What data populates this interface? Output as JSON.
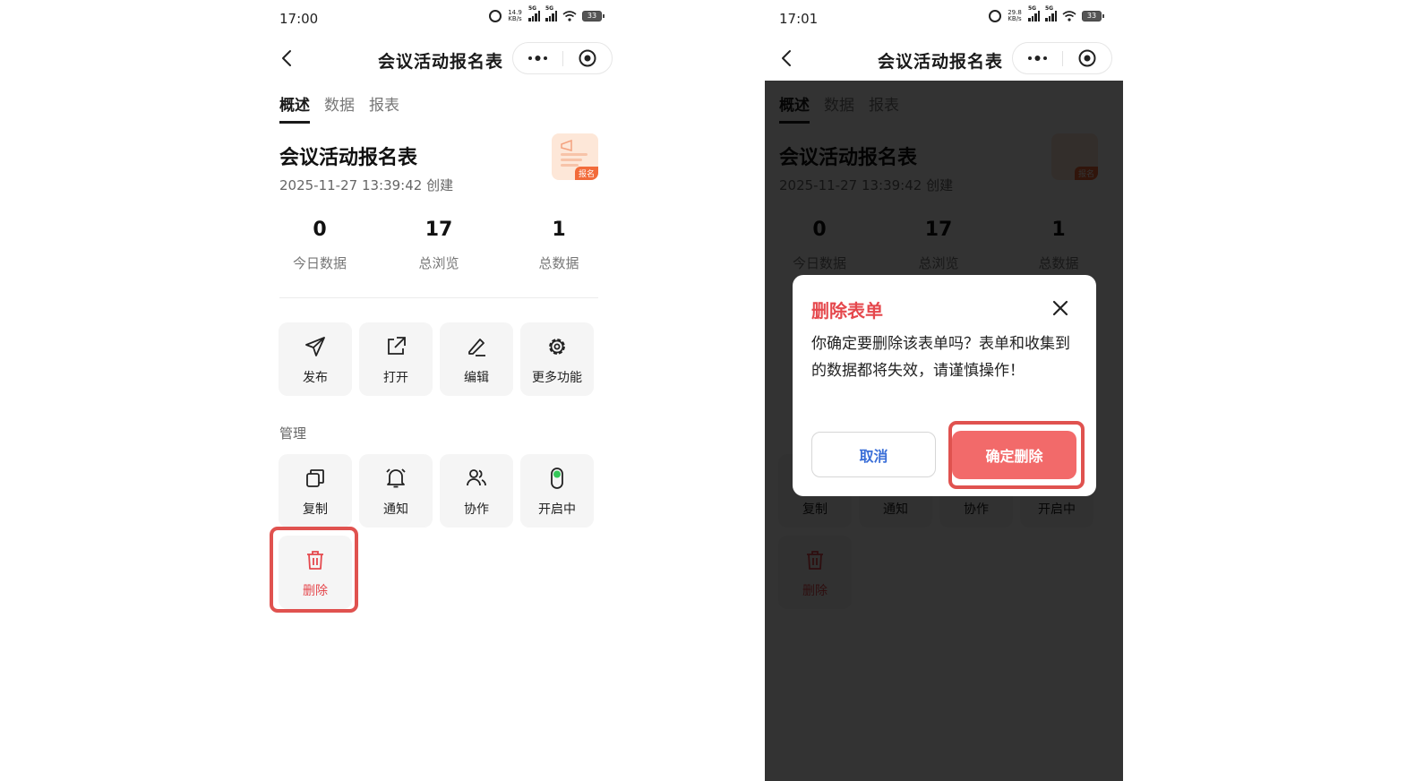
{
  "left_screen": {
    "status_time": "17:00",
    "status_speed": "14.9 KB/s",
    "network_label": "5G",
    "battery": "33",
    "nav_title": "会议活动报名表",
    "tabs": [
      {
        "label": "概述",
        "active": true
      },
      {
        "label": "数据",
        "active": false
      },
      {
        "label": "报表",
        "active": false
      }
    ],
    "form_title": "会议活动报名表",
    "form_created": "2025-11-27 13:39:42 创建",
    "thumb_tag": "报名",
    "stats": [
      {
        "value": "0",
        "label": "今日数据"
      },
      {
        "value": "17",
        "label": "总浏览"
      },
      {
        "value": "1",
        "label": "总数据"
      }
    ],
    "actions": [
      {
        "label": "发布",
        "icon": "send-icon"
      },
      {
        "label": "打开",
        "icon": "external-link-icon"
      },
      {
        "label": "编辑",
        "icon": "pencil-icon"
      },
      {
        "label": "更多功能",
        "icon": "gear-icon"
      }
    ],
    "manage_label": "管理",
    "manage": [
      {
        "label": "复制",
        "icon": "copy-icon"
      },
      {
        "label": "通知",
        "icon": "bell-icon"
      },
      {
        "label": "协作",
        "icon": "users-icon"
      },
      {
        "label": "开启中",
        "icon": "toggle-icon"
      }
    ],
    "delete_label": "删除"
  },
  "right_screen": {
    "status_time": "17:01",
    "status_speed": "29.8 KB/s",
    "dialog": {
      "title": "删除表单",
      "message": "你确定要删除该表单吗？表单和收集到的数据都将失效，请谨慎操作！",
      "cancel_label": "取消",
      "confirm_label": "确定删除"
    }
  },
  "colors": {
    "danger": "#e5484d",
    "confirm_button": "#f26a6a",
    "highlight": "#e0524f",
    "cancel_text": "#3b6fd8",
    "toggle_on": "#34c759"
  }
}
